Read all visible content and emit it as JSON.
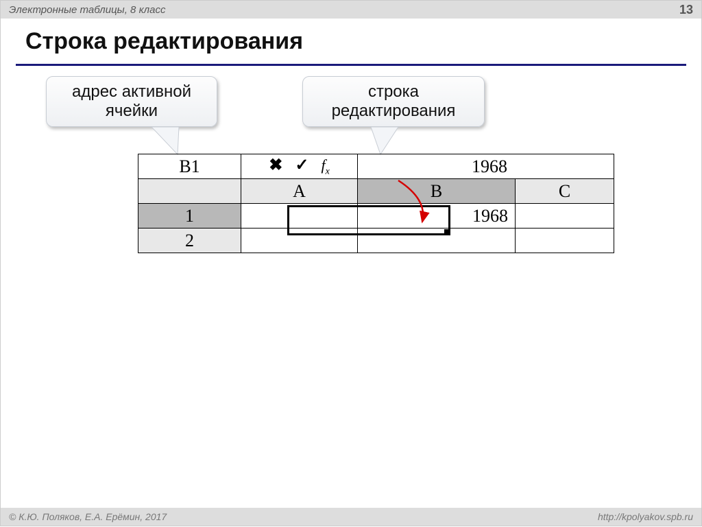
{
  "header": {
    "subject": "Электронные таблицы, 8 класс",
    "page_number": "13"
  },
  "title": "Строка редактирования",
  "callouts": {
    "address": "адрес активной\nячейки",
    "editline": "строка\nредактирования"
  },
  "formula_bar": {
    "name_box": "B1",
    "cancel_glyph": "✖",
    "accept_glyph": "✓",
    "fx_label": "f",
    "fx_sub": "x",
    "edit_value": "1968"
  },
  "grid": {
    "columns": [
      "A",
      "B",
      "C"
    ],
    "rows": [
      "1",
      "2"
    ],
    "active_column": "B",
    "active_row": "1",
    "cells": {
      "B1": "1968"
    }
  },
  "footer": {
    "copyright": "© К.Ю. Поляков, Е.А. Ерёмин, 2017",
    "url": "http://kpolyakov.spb.ru"
  }
}
